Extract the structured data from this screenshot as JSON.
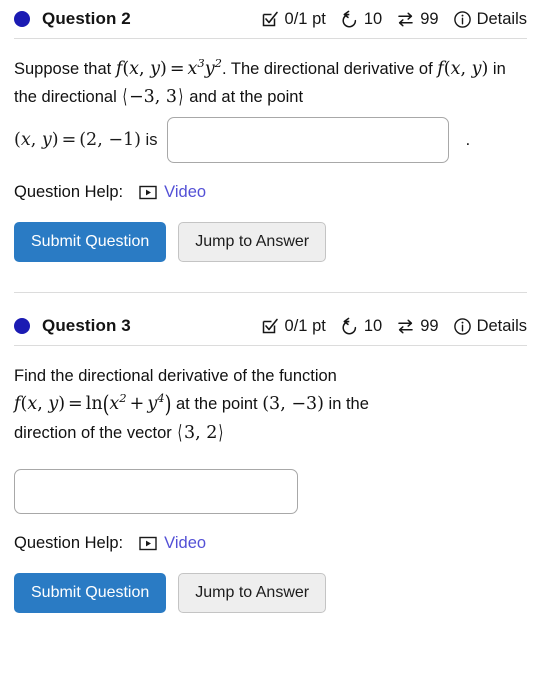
{
  "theme": {
    "question_dot_color": "#1b1bb3",
    "primary_button_color": "#2a7bc4",
    "secondary_button_color": "#eeeeee",
    "link_color": "#5350d6",
    "divider_color": "#dcdcdc"
  },
  "questions": [
    {
      "title": "Question 2",
      "meta": {
        "points": "0/1 pt",
        "attempts": "10",
        "versions": "99",
        "details_label": "Details",
        "points_icon": "checkbox-check-icon",
        "attempts_icon": "undo-arrow-icon",
        "versions_icon": "swap-arrows-icon",
        "details_icon": "info-circle-icon"
      },
      "prompt_plain": "Suppose that f(x, y) = x^3 y^2. The directional derivative of f(x, y) in the directional ⟨−3, 3⟩ and at the point (x, y) = (2, −1) is",
      "prompt_parts": {
        "lead1": "Suppose that ",
        "math1": "f(x, y) = x³y²",
        "mid1": ". The directional derivative",
        "lead2": "of ",
        "math2": "f(x, y)",
        "mid2": " in the directional ",
        "math3": "⟨−3, 3⟩",
        "mid3": " and at the point",
        "math4": "(x, y) = (2, −1)",
        "tail": " is",
        "period": "."
      },
      "answer_value": "",
      "answer_placeholder": "",
      "help_label": "Question Help:",
      "video_label": "Video",
      "submit_label": "Submit Question",
      "jump_label": "Jump to Answer"
    },
    {
      "title": "Question 3",
      "meta": {
        "points": "0/1 pt",
        "attempts": "10",
        "versions": "99",
        "details_label": "Details",
        "points_icon": "checkbox-check-icon",
        "attempts_icon": "undo-arrow-icon",
        "versions_icon": "swap-arrows-icon",
        "details_icon": "info-circle-icon"
      },
      "prompt_plain": "Find the directional derivative of the function f(x, y) = ln(x^2 + y^4) at the point (3, −3) in the direction of the vector ⟨3, 2⟩",
      "prompt_parts": {
        "line1": "Find the directional derivative of the function",
        "math1": "f(x, y) = ln(x² + y⁴)",
        "mid1": " at the point ",
        "math2": "(3, −3)",
        "mid2": " in the",
        "line3": "direction of the vector ",
        "math3": "⟨3, 2⟩"
      },
      "answer_value": "",
      "answer_placeholder": "",
      "help_label": "Question Help:",
      "video_label": "Video",
      "submit_label": "Submit Question",
      "jump_label": "Jump to Answer"
    }
  ]
}
